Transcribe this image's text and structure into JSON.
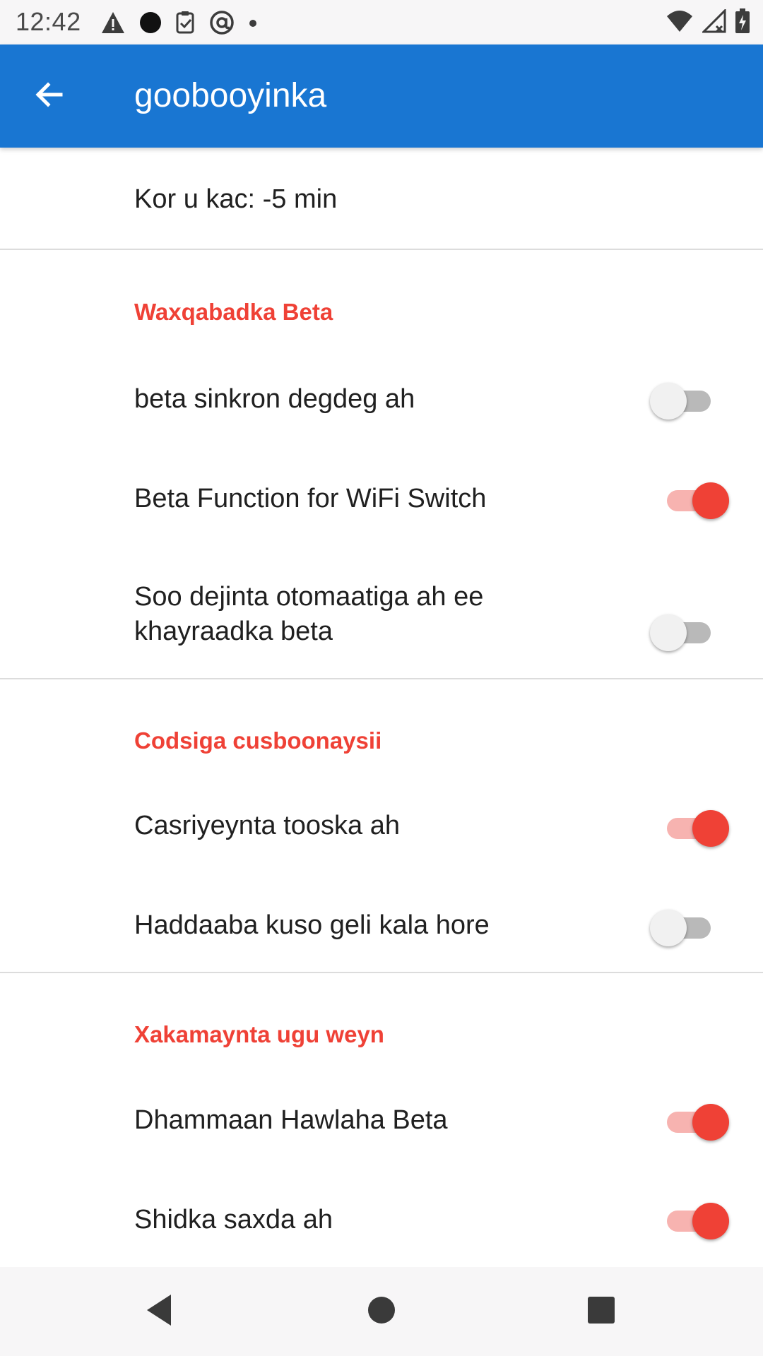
{
  "status_bar": {
    "time": "12:42",
    "left_icons": [
      "warning-icon",
      "circle-icon",
      "clipboard-check-icon",
      "at-sign-icon",
      "dot-icon"
    ],
    "right_icons": [
      "wifi-icon",
      "signal-icon",
      "battery-icon"
    ]
  },
  "app_bar": {
    "title": "goobooyinka",
    "back_icon": "arrow-back-icon",
    "background_color": "#1976d2"
  },
  "preferences": {
    "top_item": {
      "label": "Kor u kac: -5 min"
    },
    "beta_category": {
      "title": "Waxqabadka Beta",
      "items": [
        {
          "label": "beta sinkron degdeg ah",
          "enabled": false
        },
        {
          "label": "Beta Function for WiFi Switch",
          "enabled": true
        },
        {
          "label_line1": "Soo dejinta otomaatiga ah ee",
          "label_line2": "khayraadka beta",
          "enabled": false
        }
      ]
    },
    "update_category": {
      "title": "Codsiga cusboonaysii",
      "items": [
        {
          "label": "Casriyeynta tooska ah",
          "enabled": true
        },
        {
          "label": "Haddaaba kuso geli kala hore",
          "enabled": false
        }
      ]
    },
    "control_category": {
      "title": "Xakamaynta ugu weyn",
      "items": [
        {
          "label": "Dhammaan Hawlaha Beta",
          "enabled": true
        },
        {
          "label": "Shidka saxda ah",
          "enabled": true
        }
      ]
    }
  },
  "colors": {
    "accent": "#ef4136",
    "accent_track": "#f7b3b0",
    "switch_off_thumb": "#f1f1f1",
    "switch_off_track": "#b9b9b9"
  },
  "nav_bar": {
    "buttons": [
      "back-triangle-icon",
      "home-circle-icon",
      "recents-square-icon"
    ]
  }
}
